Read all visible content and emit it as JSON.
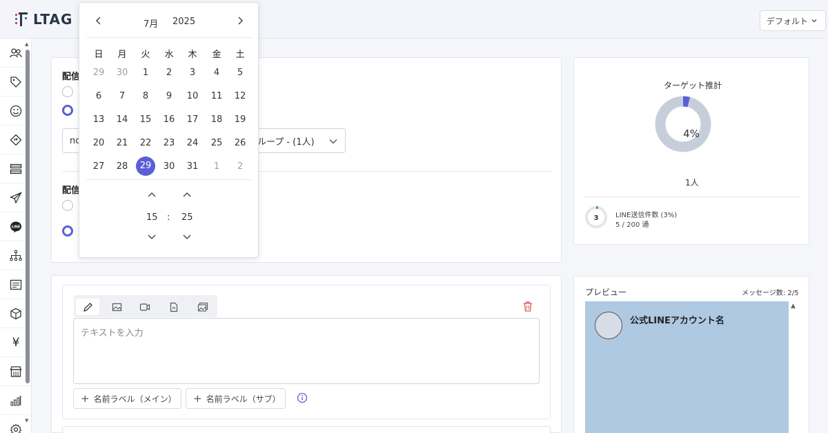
{
  "header": {
    "logo_text": "LTAG",
    "default_select": "デフォルト"
  },
  "sidebar": {
    "icons": [
      "users-icon",
      "tag-icon",
      "smile-icon",
      "diamond-arrow-icon",
      "card-stack-icon",
      "send-icon",
      "line-icon",
      "org-chart-icon",
      "message-icon",
      "cube-icon",
      "yen-icon",
      "store-icon",
      "bar-chart-icon",
      "gear-icon"
    ],
    "yen_glyph": "¥",
    "line_glyph": "LINE"
  },
  "delivery": {
    "section1_label": "配信",
    "section2_label": "配信",
    "select_prefix": "no",
    "select_text": "ループ - (1人)"
  },
  "calendar": {
    "month": "7月",
    "year": "2025",
    "prev": "‹",
    "next": "›",
    "weekdays": [
      "日",
      "月",
      "火",
      "水",
      "木",
      "金",
      "土"
    ],
    "weeks": [
      [
        "29",
        "30",
        "1",
        "2",
        "3",
        "4",
        "5"
      ],
      [
        "6",
        "7",
        "8",
        "9",
        "10",
        "11",
        "12"
      ],
      [
        "13",
        "14",
        "15",
        "16",
        "17",
        "18",
        "19"
      ],
      [
        "20",
        "21",
        "22",
        "23",
        "24",
        "25",
        "26"
      ],
      [
        "27",
        "28",
        "29",
        "30",
        "31",
        "1",
        "2"
      ]
    ],
    "selected": "29",
    "hour": "15",
    "colon": ":",
    "minute": "25"
  },
  "target": {
    "title": "ターゲット推計",
    "percent_label": "4%",
    "percent_value": 4,
    "count": "1人",
    "line_badge": "3",
    "line_label": "LINE送信件数 (3%)",
    "line_sub": "5 / 200 通",
    "line_percent_value": 3,
    "accent": "#5a5fd6",
    "ring_color": "#c7cedb"
  },
  "editor": {
    "placeholder": "テキストを入力",
    "name_label_main": "名前ラベル（メイン）",
    "name_label_sub": "名前ラベル（サブ）",
    "delete_color": "#e05050"
  },
  "preview": {
    "label": "プレビュー",
    "message_count": "メッセージ数: 2/5",
    "account_name": "公式LINEアカウント名"
  }
}
